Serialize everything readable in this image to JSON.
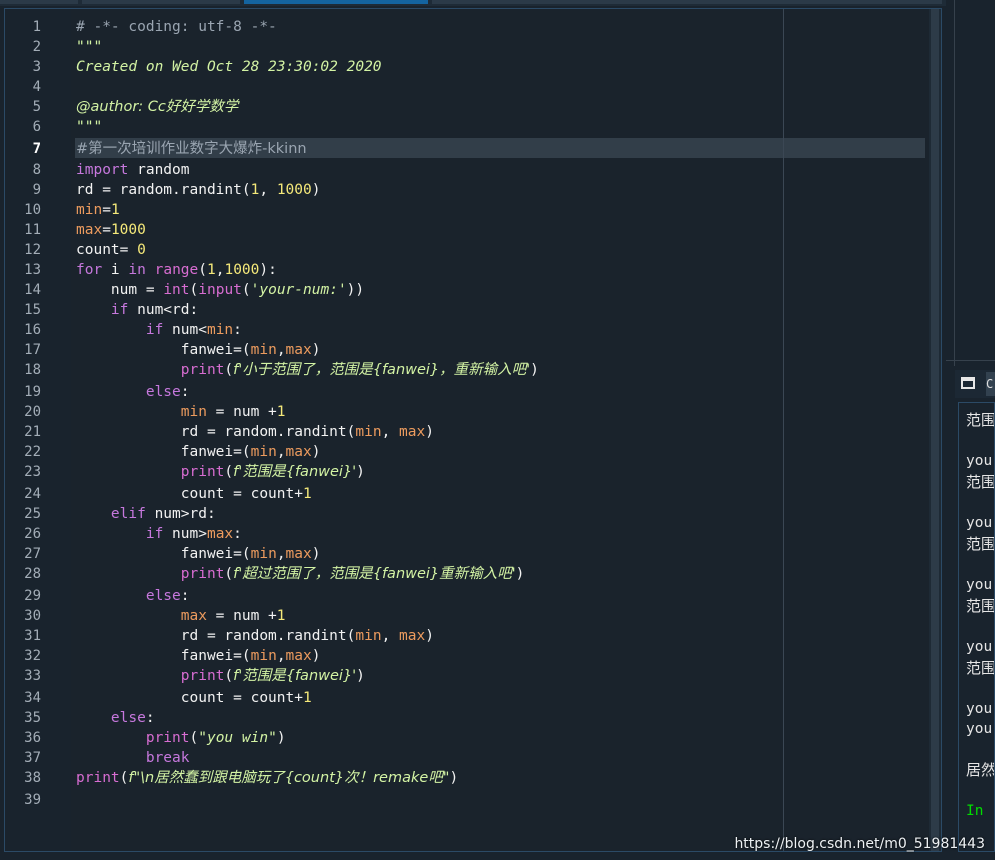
{
  "editor": {
    "current_line": 7,
    "line_numbers": [
      "1",
      "2",
      "3",
      "4",
      "5",
      "6",
      "7",
      "8",
      "9",
      "10",
      "11",
      "12",
      "13",
      "14",
      "15",
      "16",
      "17",
      "18",
      "19",
      "20",
      "21",
      "22",
      "23",
      "24",
      "25",
      "26",
      "27",
      "28",
      "29",
      "30",
      "31",
      "32",
      "33",
      "34",
      "35",
      "36",
      "37",
      "38",
      "39"
    ],
    "lines": {
      "l1": "# -*- coding: utf-8 -*-",
      "l2": "\"\"\"",
      "l3": "Created on Wed Oct 28 23:30:02 2020",
      "l5": "@author: Cc好好学数学",
      "l6": "\"\"\"",
      "l7": "#第一次培训作业数字大爆炸-kkinn",
      "l8_kw": "import",
      "l8_rest": " random",
      "l9_a": "rd = random.randint(",
      "l9_n1": "1",
      "l9_b": ", ",
      "l9_n2": "1000",
      "l9_c": ")",
      "l10_v": "min",
      "l10_eq": "=",
      "l10_n": "1",
      "l11_v": "max",
      "l11_eq": "=",
      "l11_n": "1000",
      "l12_a": "count= ",
      "l12_n": "0",
      "l13_kw1": "for",
      "l13_a": " i ",
      "l13_kw2": "in",
      "l13_sp": " ",
      "l13_bi": "range",
      "l13_b": "(",
      "l13_n1": "1",
      "l13_c": ",",
      "l13_n2": "1000",
      "l13_d": "):",
      "l14_a": "    num = ",
      "l14_bi1": "int",
      "l14_b": "(",
      "l14_bi2": "input",
      "l14_c": "(",
      "l14_s": "'your-num:'",
      "l14_d": "))",
      "l15_kw": "    if",
      "l15_a": " num<rd:",
      "l16_kw": "        if",
      "l16_a": " num<",
      "l16_v": "min",
      "l16_b": ":",
      "l17_a": "            fanwei=(",
      "l17_v1": "min",
      "l17_b": ",",
      "l17_v2": "max",
      "l17_c": ")",
      "l18_bi": "            print",
      "l18_a": "(",
      "l18_s": "f'小于范围了，范围是{fanwei}，重新输入吧'",
      "l18_b": ")",
      "l19_kw": "        else",
      "l19_a": ":",
      "l20_v": "            min",
      "l20_a": " = num +",
      "l20_n": "1",
      "l21_a": "            rd = random.randint(",
      "l21_v1": "min",
      "l21_b": ", ",
      "l21_v2": "max",
      "l21_c": ")",
      "l22_a": "            fanwei=(",
      "l22_v1": "min",
      "l22_b": ",",
      "l22_v2": "max",
      "l22_c": ")",
      "l23_bi": "            print",
      "l23_a": "(",
      "l23_s": "f'范围是{fanwei}'",
      "l23_b": ")",
      "l24_a": "            count = count+",
      "l24_n": "1",
      "l25_kw": "    elif",
      "l25_a": " num>rd:",
      "l26_kw": "        if",
      "l26_a": " num>",
      "l26_v": "max",
      "l26_b": ":",
      "l27_a": "            fanwei=(",
      "l27_v1": "min",
      "l27_b": ",",
      "l27_v2": "max",
      "l27_c": ")",
      "l28_bi": "            print",
      "l28_a": "(",
      "l28_s": "f'超过范围了，范围是{fanwei}重新输入吧'",
      "l28_b": ")",
      "l29_kw": "        else",
      "l29_a": ":",
      "l30_v": "            max",
      "l30_a": " = num +",
      "l30_n": "1",
      "l31_a": "            rd = random.randint(",
      "l31_v1": "min",
      "l31_b": ", ",
      "l31_v2": "max",
      "l31_c": ")",
      "l32_a": "            fanwei=(",
      "l32_v1": "min",
      "l32_b": ",",
      "l32_v2": "max",
      "l32_c": ")",
      "l33_bi": "            print",
      "l33_a": "(",
      "l33_s": "f'范围是{fanwei}'",
      "l33_b": ")",
      "l34_a": "            count = count+",
      "l34_n": "1",
      "l35_kw": "    else",
      "l35_a": ":",
      "l36_bi": "        print",
      "l36_a": "(",
      "l36_s": "\"you win\"",
      "l36_b": ")",
      "l37_kw": "        break",
      "l38_bi": "print",
      "l38_a": "(",
      "l38_s": "f\"\\n居然蠢到跟电脑玩了{count}次！remake吧\"",
      "l38_b": ")"
    }
  },
  "console": {
    "tab_label": "C",
    "lines": [
      "范围",
      "you",
      "范围",
      "you",
      "范围",
      "you",
      "范围",
      "you",
      "范围",
      "you",
      "you",
      "居然",
      "In"
    ]
  },
  "watermark": "https://blog.csdn.net/m0_51981443"
}
